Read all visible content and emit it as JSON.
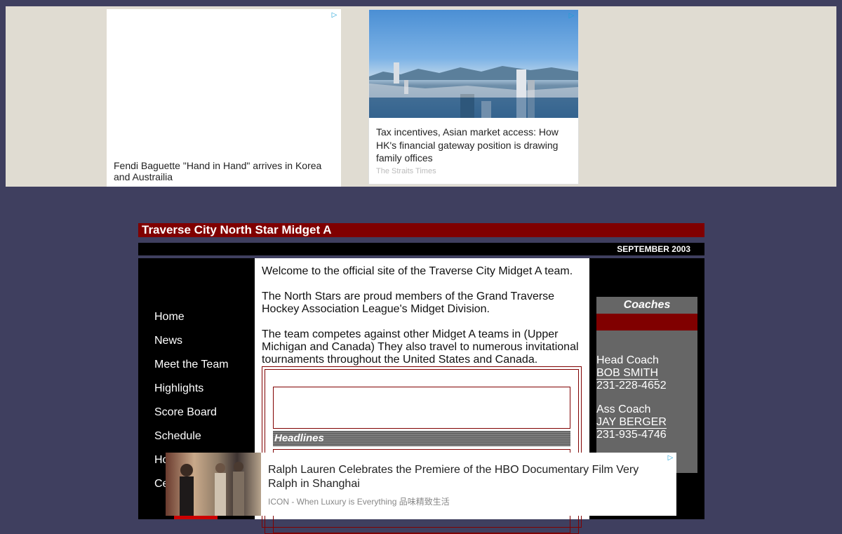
{
  "ads": {
    "left": {
      "title": "Fendi Baguette \"Hand in Hand\" arrives in Korea and Austrailia"
    },
    "right": {
      "title": "Tax incentives, Asian market access: How HK's financial gateway position is drawing family offices",
      "source": "The Straits Times"
    },
    "bottom": {
      "title": "Ralph Lauren Celebrates the Premiere of the HBO Documentary Film Very Ralph in Shanghai",
      "source": "ICON - When Luxury is Everything 品味精致生活"
    },
    "choice_glyph": "▷"
  },
  "site": {
    "title": "Traverse City North Star Midget A",
    "date": "SEPTEMBER 2003"
  },
  "nav": [
    "Home",
    "News",
    "Meet the Team",
    "Highlights",
    "Score Board",
    "Schedule",
    "Ho",
    "Ce"
  ],
  "content": {
    "para1": "Welcome to the official site of the Traverse City Midget A team.",
    "para2": "The North Stars are proud members of the Grand Traverse Hockey Association League's Midget Division.",
    "para3": "The team competes against other Midget A teams in (Upper Michigan and Canada) They also travel to numerous invitational tournaments throughout the United States and Canada.",
    "headlines": "Headlines"
  },
  "coaches": {
    "heading": "Coaches",
    "head_coach": {
      "role": "Head Coach",
      "name": "BOB SMITH",
      "phone": "231-228-4652"
    },
    "ass_coach": {
      "role": "Ass Coach",
      "name": "JAY BERGER",
      "phone": "231-935-4746"
    }
  },
  "colors": {
    "page_bg": "#3f3f5f",
    "ad_band": "#e0dcd2",
    "maroon": "#800000",
    "coach_panel": "#666666"
  }
}
